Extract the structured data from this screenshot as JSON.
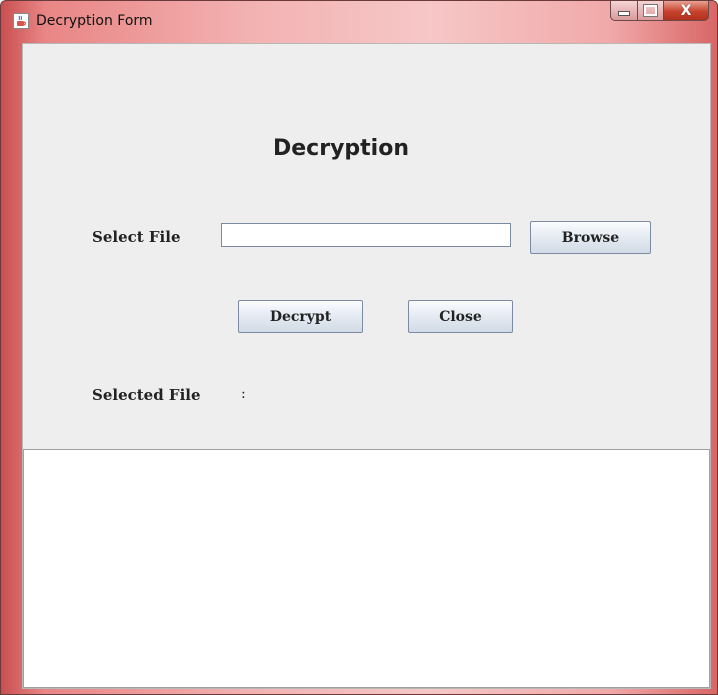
{
  "window": {
    "title": "Decryption Form",
    "icon": "java-cup-icon",
    "controls": {
      "minimize": "minimize-icon",
      "maximize": "maximize-icon",
      "close": "X"
    }
  },
  "form": {
    "heading": "Decryption",
    "select_file_label": "Select File",
    "file_input_value": "",
    "browse_label": "Browse",
    "decrypt_label": "Decrypt",
    "close_label": "Close",
    "selected_file_label": "Selected File",
    "selected_file_separator": ":",
    "output_text": ""
  }
}
